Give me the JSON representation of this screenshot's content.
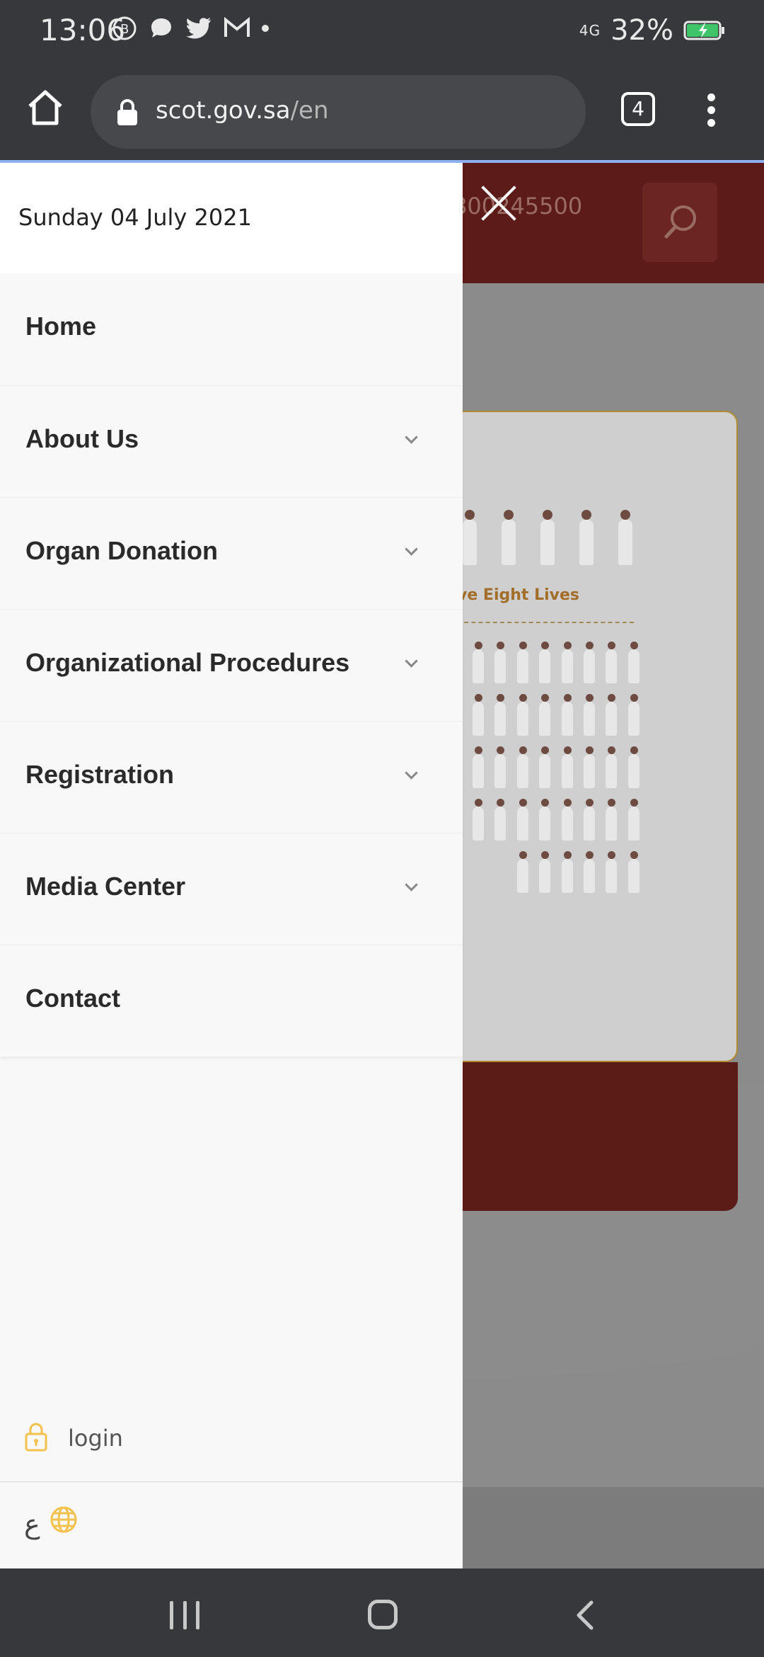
{
  "status_bar": {
    "time": "13:06",
    "network": "4G",
    "battery": "32%"
  },
  "browser": {
    "url_host": "scot.gov.sa",
    "url_path": "/en",
    "tab_count": "4"
  },
  "page_behind": {
    "phone": "800245500",
    "card_caption": "ve Eight Lives"
  },
  "drawer": {
    "date": "Sunday 04 July 2021",
    "nav_items": [
      {
        "label": "Home"
      },
      {
        "label": "About Us"
      },
      {
        "label": "Organ Donation"
      },
      {
        "label": "Organizational Procedures"
      },
      {
        "label": "Registration"
      },
      {
        "label": "Media Center"
      },
      {
        "label": "Contact"
      }
    ],
    "login_label": "login",
    "language_letter": "ع"
  },
  "colors": {
    "accent_yellow": "#f2c14e",
    "brand_red": "#7a1f1c"
  }
}
